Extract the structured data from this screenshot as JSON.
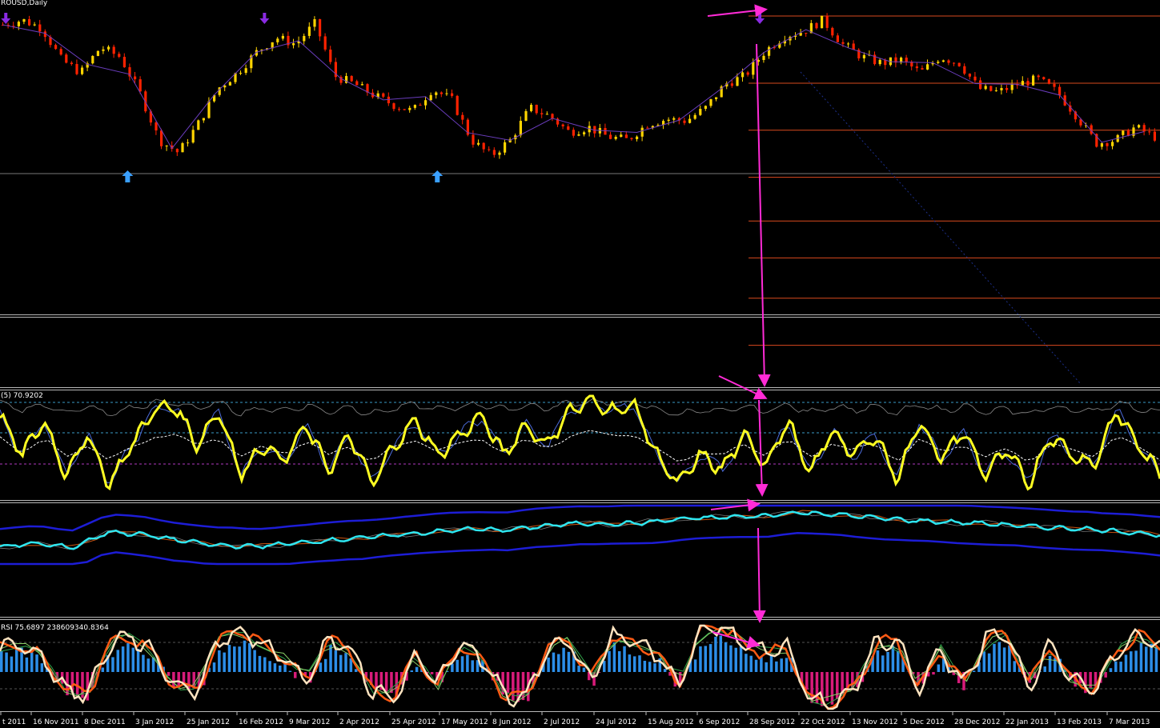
{
  "window": {
    "title": "EURUSD,Daily",
    "title_visible": "ROUSD,Daily"
  },
  "colors": {
    "background": "#000000",
    "bull_candle": "#ffd400",
    "bear_candle": "#ff2200",
    "level_line": "#d94a1e",
    "arrow": "#ff2bd6",
    "rsi_line": "#ffff22",
    "cci_line": "#2ee6f0",
    "band_line": "#1d1dd6",
    "histogram_up": "#2c8ee8",
    "histogram_down": "#d81b7a",
    "stoch_main": "#ffe4c0",
    "stoch_signal": "#ff5a14",
    "fractal_up": "#3aa0ff",
    "fractal_down": "#8a2be2"
  },
  "chart_data": [
    {
      "type": "candlestick",
      "panel": "price",
      "title": "ROUSD,Daily",
      "x_dates": [
        "t 2011",
        "16 Nov 2011",
        "8 Dec 2011",
        "3 Jan 2012",
        "25 Jan 2012",
        "16 Feb 2012",
        "9 Mar 2012",
        "2 Apr 2012",
        "25 Apr 2012",
        "17 May 2012",
        "8 Jun 2012",
        "2 Jul 2012",
        "24 Jul 2012",
        "15 Aug 2012",
        "6 Sep 2012",
        "28 Sep 2012",
        "22 Oct 2012",
        "13 Nov 2012",
        "5 Dec 2012",
        "28 Dec 2012",
        "22 Jan 2013",
        "13 Feb 2013",
        "7 Mar 2013"
      ],
      "close_path": [
        0.92,
        0.95,
        0.9,
        0.7,
        0.62,
        0.78,
        0.72,
        0.5,
        0.2,
        0.12,
        0.3,
        0.52,
        0.62,
        0.75,
        0.84,
        0.8,
        0.93,
        0.6,
        0.55,
        0.48,
        0.42,
        0.38,
        0.52,
        0.45,
        0.2,
        0.1,
        0.2,
        0.4,
        0.35,
        0.25,
        0.28,
        0.22,
        0.2,
        0.3,
        0.33,
        0.32,
        0.4,
        0.55,
        0.6,
        0.75,
        0.85,
        0.88,
        0.95,
        0.8,
        0.72,
        0.68,
        0.7,
        0.62,
        0.72,
        0.68,
        0.52,
        0.5,
        0.55,
        0.58,
        0.5,
        0.35,
        0.18,
        0.2,
        0.28,
        0.22
      ],
      "fractals": [
        {
          "position": 0.11,
          "direction": "up"
        },
        {
          "position": 0.377,
          "direction": "up"
        },
        {
          "position": 0.005,
          "direction": "down"
        },
        {
          "position": 0.228,
          "direction": "down"
        },
        {
          "position": 0.655,
          "direction": "down"
        }
      ],
      "horizontal_levels": [
        0.02,
        0.16,
        0.28,
        0.39,
        0.52,
        0.66,
        0.8,
        0.98
      ]
    },
    {
      "type": "line",
      "panel": "rsi",
      "label": "(5) 70.9202",
      "series": [
        {
          "values": [
            0.8,
            0.4,
            0.75,
            0.2,
            0.6,
            0.1,
            0.5,
            0.85,
            0.9,
            0.5,
            0.85,
            0.2,
            0.5,
            0.35,
            0.7,
            0.25,
            0.6,
            0.1,
            0.5,
            0.75,
            0.4,
            0.6,
            0.8,
            0.4,
            0.7,
            0.5,
            0.85,
            0.95,
            0.85,
            0.9,
            0.4,
            0.1,
            0.4,
            0.25,
            0.6,
            0.3,
            0.75,
            0.2,
            0.65,
            0.4,
            0.6,
            0.15,
            0.75,
            0.35,
            0.65,
            0.2,
            0.45,
            0.1,
            0.6,
            0.4,
            0.3,
            0.85,
            0.5,
            0.2
          ]
        }
      ]
    },
    {
      "type": "line",
      "panel": "cci",
      "label": "",
      "series": [
        {
          "values": [
            0.3,
            0.35,
            0.28,
            0.55,
            0.5,
            0.4,
            0.32,
            0.3,
            0.35,
            0.4,
            0.45,
            0.5,
            0.55,
            0.6,
            0.58,
            0.65,
            0.7,
            0.68,
            0.72,
            0.78,
            0.8,
            0.82,
            0.88,
            0.85,
            0.8,
            0.75,
            0.72,
            0.7,
            0.66,
            0.62,
            0.6,
            0.55,
            0.5
          ]
        }
      ]
    },
    {
      "type": "histogram",
      "panel": "stoch",
      "label": "RSI 75.6897 238609340.8364",
      "histogram_values": [
        0.4,
        0.5,
        0.2,
        -0.5,
        -0.6,
        0.5,
        0.7,
        0.3,
        -0.4,
        -0.5,
        0.6,
        0.8,
        0.5,
        0.2,
        -0.3,
        0.6,
        0.4,
        -0.5,
        -0.7,
        0.3,
        -0.4,
        0.5,
        0.2,
        -0.6,
        -0.7,
        0.4,
        0.6,
        -0.3,
        0.7,
        0.5,
        0.3,
        -0.4,
        0.8,
        0.9,
        0.5,
        0.3,
        0.4,
        -0.7,
        -0.8,
        -0.5,
        0.5,
        0.6,
        -0.5,
        0.4,
        -0.4,
        0.6,
        0.7,
        -0.4,
        0.5,
        -0.3,
        -0.5,
        0.3,
        0.7,
        0.5
      ]
    }
  ]
}
